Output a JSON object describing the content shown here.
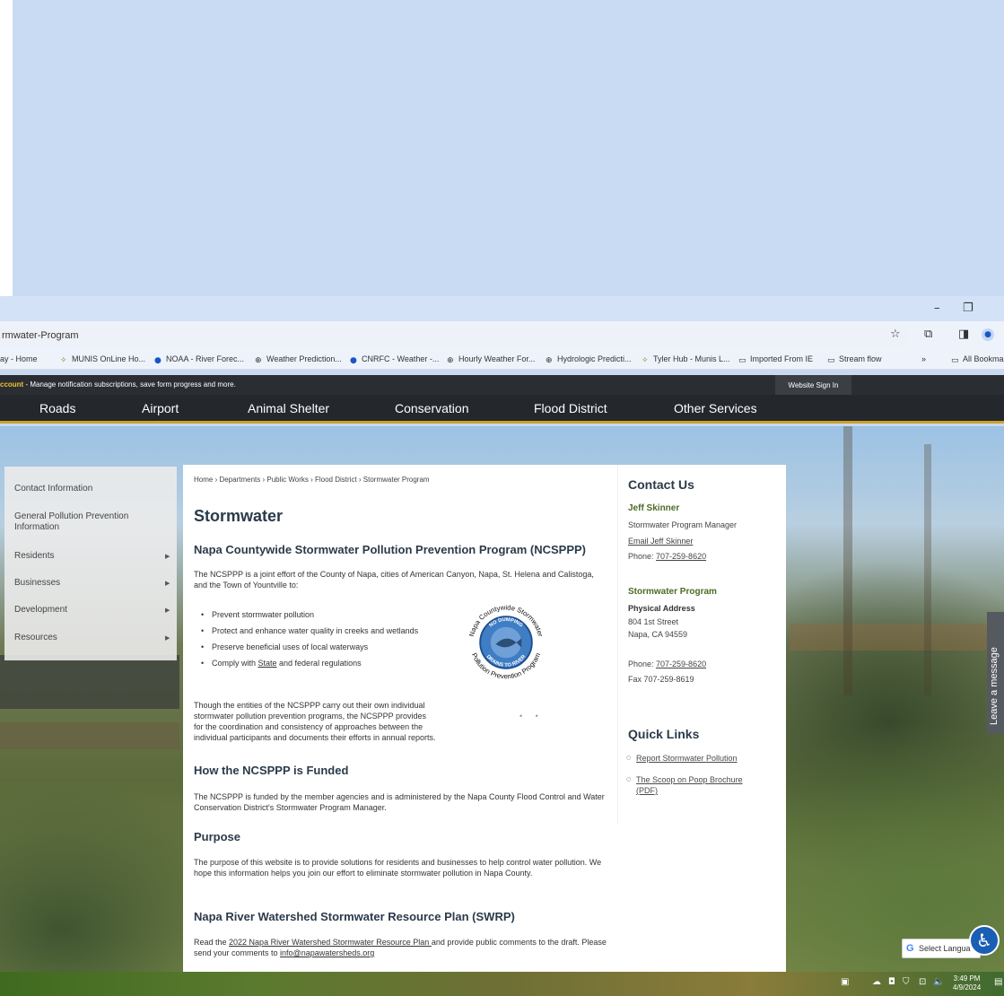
{
  "browser": {
    "url": "rmwater-Program",
    "window_controls": {
      "minimize": "–",
      "restore": "❐"
    },
    "bookmarks": [
      {
        "label": "ay - Home",
        "icon": "none"
      },
      {
        "label": "MUNIS OnLine Ho...",
        "icon": "tyler-icon"
      },
      {
        "label": "NOAA - River Forec...",
        "icon": "noaa-icon"
      },
      {
        "label": "Weather Prediction...",
        "icon": "globe-icon"
      },
      {
        "label": "CNRFC - Weather -...",
        "icon": "noaa-icon"
      },
      {
        "label": "Hourly Weather For...",
        "icon": "globe-icon"
      },
      {
        "label": "Hydrologic Predicti...",
        "icon": "globe-icon"
      },
      {
        "label": "Tyler Hub - Munis L...",
        "icon": "tyler-icon"
      },
      {
        "label": "Imported From IE",
        "icon": "folder-icon"
      },
      {
        "label": "Stream flow",
        "icon": "folder-icon"
      },
      {
        "label": "»",
        "icon": "none"
      },
      {
        "label": "All Bookma",
        "icon": "folder-icon"
      }
    ]
  },
  "notice": {
    "prefix": "ccount",
    "text": " - Manage notification subscriptions, save form progress and more.",
    "signin": "Website Sign In"
  },
  "nav": [
    "Roads",
    "Airport",
    "Animal Shelter",
    "Conservation",
    "Flood District",
    "Other Services"
  ],
  "sidenav": [
    {
      "label": "Contact Information",
      "arrow": ""
    },
    {
      "label": "General Pollution Prevention Information",
      "arrow": ""
    },
    {
      "label": "Residents",
      "arrow": "▶"
    },
    {
      "label": "Businesses",
      "arrow": "▶"
    },
    {
      "label": "Development",
      "arrow": "▶"
    },
    {
      "label": "Resources",
      "arrow": "▶"
    }
  ],
  "breadcrumb": "Home › Departments › Public Works › Flood District › Stormwater Program",
  "page_title": "Stormwater",
  "section1": {
    "heading": "Napa Countywide Stormwater Pollution Prevention Program (NCSPPP)",
    "intro": "The NCSPPP is a joint effort of the County of Napa, cities of American Canyon, Napa, St. Helena and Calistoga, and the Town of Yountville to:",
    "bullets": [
      "Prevent stormwater pollution",
      "Protect and enhance water quality in creeks and wetlands",
      "Preserve beneficial uses of local waterways"
    ],
    "bullet4_before": "Comply with ",
    "bullet4_link": "State",
    "bullet4_after": " and federal regulations",
    "body": "Though the entities of the NCSPPP carry out their own individual stormwater pollution prevention programs, the NCSPPP provides for the coordination and consistency of approaches between the individual participants and documents their efforts in annual reports.",
    "carousel_dots": "• •"
  },
  "logo": {
    "outer_top": "Napa Countywide Stormwater",
    "outer_bottom": "Pollution Prevention Program",
    "inner_top": "NO DUMPING",
    "inner_bottom": "DRAINS TO RIVER"
  },
  "section2": {
    "heading": "How the NCSPPP is Funded",
    "body": "The NCSPPP is funded by the member agencies and is administered by the Napa County Flood Control and Water Conservation District's Stormwater Program Manager."
  },
  "section3": {
    "heading": "Purpose",
    "body": "The purpose of this website is to provide solutions for residents and businesses to help control water pollution. We hope this information helps you join our effort to eliminate stormwater pollution in Napa County."
  },
  "section4": {
    "heading": "Napa River Watershed Stormwater Resource Plan (SWRP)",
    "before": "Read the ",
    "link": "2022 Napa River Watershed Stormwater Resource Plan ",
    "middle": "and provide public comments to the draft. Please send your comments to ",
    "email": "info@napawatersheds.org"
  },
  "contact": {
    "heading": "Contact Us",
    "name": "Jeff Skinner",
    "title": "Stormwater Program Manager",
    "email_link": "Email Jeff Skinner",
    "phone_label": "Phone: ",
    "phone": "707-259-8620",
    "program": "Stormwater Program",
    "address_label": "Physical Address",
    "address1": "804 1st Street",
    "address2": "Napa, CA 94559",
    "phone2_label": "Phone: ",
    "phone2": "707-259-8620",
    "fax": "Fax 707-259-8619"
  },
  "quick_links": {
    "heading": "Quick Links",
    "items": [
      "Report Stormwater Pollution",
      "The Scoop on Poop Brochure (PDF)"
    ]
  },
  "feedback_tab": "Leave a message",
  "translate": {
    "g": "G",
    "label": "Select Langua"
  },
  "taskbar": {
    "time": "3:49 PM",
    "date": "4/9/2024"
  }
}
